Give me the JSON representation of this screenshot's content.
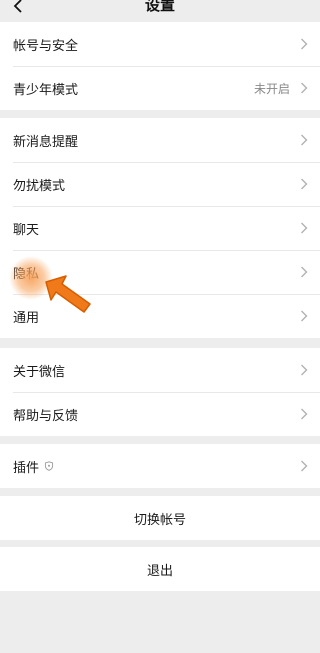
{
  "header": {
    "title": "设置",
    "back_icon": "chevron-left-icon"
  },
  "group1": [
    {
      "label": "帐号与安全"
    },
    {
      "label": "青少年模式",
      "value": "未开启"
    }
  ],
  "group2": [
    {
      "label": "新消息提醒"
    },
    {
      "label": "勿扰模式"
    },
    {
      "label": "聊天"
    },
    {
      "label": "隐私"
    },
    {
      "label": "通用"
    }
  ],
  "group3": [
    {
      "label": "关于微信"
    },
    {
      "label": "帮助与反馈"
    }
  ],
  "group4": [
    {
      "label": "插件",
      "icon": "shield-icon"
    }
  ],
  "actions": {
    "switch_account": "切换帐号",
    "logout": "退出"
  },
  "colors": {
    "background": "#ededed",
    "row": "#ffffff",
    "accent": "#f07a1a"
  }
}
